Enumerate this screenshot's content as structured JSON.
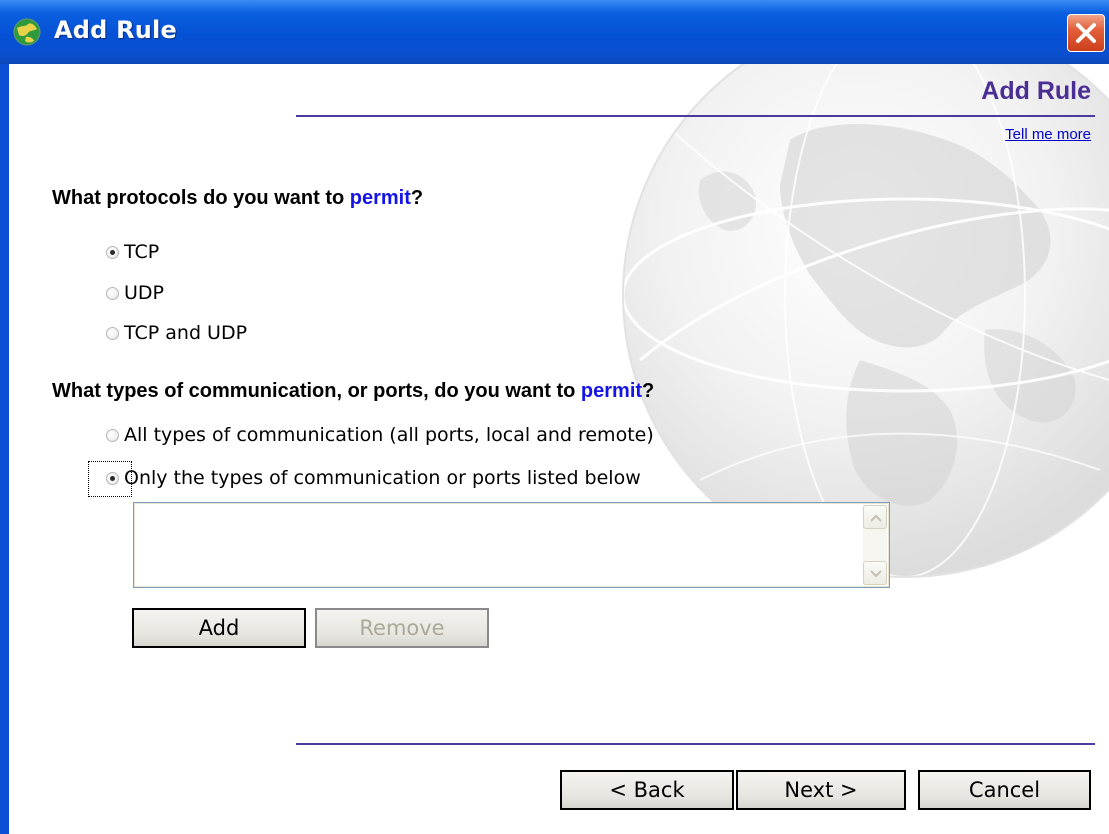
{
  "window": {
    "title": "Add Rule",
    "close_icon": "close-icon"
  },
  "header": {
    "title": "Add Rule",
    "help_link": "Tell me more"
  },
  "protocol_section": {
    "question_prefix": "What protocols do you want to ",
    "question_highlight": "permit",
    "question_suffix": "?",
    "options": [
      {
        "label": "TCP",
        "checked": true
      },
      {
        "label": "UDP",
        "checked": false
      },
      {
        "label": "TCP and UDP",
        "checked": false
      }
    ]
  },
  "ports_section": {
    "question_prefix": "What types of communication, or ports, do you want to ",
    "question_highlight": "permit",
    "question_suffix": "?",
    "options": [
      {
        "label": "All types of communication (all ports, local and remote)",
        "checked": false
      },
      {
        "label": "Only the types of communication or ports listed below",
        "checked": true
      }
    ],
    "list_items": [],
    "add_label": "Add",
    "remove_label": "Remove"
  },
  "footer": {
    "back_label": "< Back",
    "next_label": "Next >",
    "cancel_label": "Cancel"
  },
  "colors": {
    "titlebar": "#0551d6",
    "accent": "#4b2e93",
    "permit": "#1515e6",
    "link": "#0000cc"
  }
}
